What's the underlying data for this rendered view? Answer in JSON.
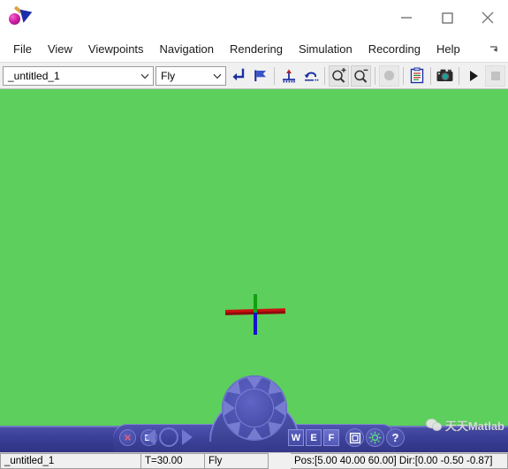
{
  "window": {
    "title": "",
    "app_icon": "webots-logo-icon",
    "controls": [
      {
        "name": "minimize-button",
        "icon": "minimize-icon",
        "label": "—"
      },
      {
        "name": "maximize-button",
        "icon": "maximize-icon",
        "label": "□"
      },
      {
        "name": "close-button",
        "icon": "close-icon",
        "label": "✕"
      }
    ]
  },
  "menubar": {
    "items": [
      {
        "label": "File"
      },
      {
        "label": "View"
      },
      {
        "label": "Viewpoints"
      },
      {
        "label": "Navigation"
      },
      {
        "label": "Rendering"
      },
      {
        "label": "Simulation"
      },
      {
        "label": "Recording"
      },
      {
        "label": "Help"
      }
    ],
    "overflow_icon": "overflow-chevron-icon"
  },
  "toolbar": {
    "world_combo": {
      "value": "_untitled_1",
      "placeholder": "_untitled_1",
      "icon": "chevron-down-icon"
    },
    "mode_combo": {
      "value": "Fly",
      "placeholder": "Fly",
      "icon": "chevron-down-icon"
    },
    "buttons": [
      {
        "name": "apply-button",
        "icon": "enter-arrow-icon",
        "label": "Apply",
        "enabled": true
      },
      {
        "name": "flag-button",
        "icon": "flag-icon",
        "label": "Flag",
        "enabled": true
      },
      {
        "name": "reset-viewpoint-button",
        "icon": "anchor-icon",
        "label": "Reset",
        "enabled": true
      },
      {
        "name": "undo-move-button",
        "icon": "undo-arrow-icon",
        "label": "Undo",
        "enabled": true
      },
      {
        "name": "zoom-in-button",
        "icon": "zoom-in-icon",
        "label": "Zoom In",
        "enabled": true
      },
      {
        "name": "zoom-out-button",
        "icon": "zoom-out-icon",
        "label": "Zoom Out",
        "enabled": true
      },
      {
        "name": "record-button",
        "icon": "record-circle-icon",
        "label": "Record",
        "enabled": false
      },
      {
        "name": "console-button",
        "icon": "clipboard-icon",
        "label": "Console",
        "enabled": true
      },
      {
        "name": "screenshot-button",
        "icon": "camera-icon",
        "label": "Screenshot",
        "enabled": true
      },
      {
        "name": "play-button",
        "icon": "play-icon",
        "label": "Play",
        "enabled": true
      },
      {
        "name": "stop-button",
        "icon": "stop-square-icon",
        "label": "Stop",
        "enabled": false
      }
    ]
  },
  "viewport": {
    "background_color": "#5CCF5C",
    "axis_gizmo": {
      "name": "axis-gizmo",
      "x_axis_color": "#CC1111",
      "y_axis_color": "#12A012",
      "z_axis_color": "#1414CC"
    }
  },
  "dashboard": {
    "left_buttons": [
      {
        "name": "dash-close-button",
        "icon": "x-circle-icon",
        "glyph": "✕"
      },
      {
        "name": "dash-minimize-button",
        "icon": "window-icon",
        "glyph": "▬"
      }
    ],
    "nav_arrows": {
      "left": {
        "name": "dash-rotate-left-button",
        "icon": "triangle-left-icon"
      },
      "right": {
        "name": "dash-rotate-right-button",
        "icon": "triangle-right-icon"
      },
      "ring": {
        "name": "dash-orbit-ring",
        "icon": "ring-icon"
      }
    },
    "knob": {
      "name": "dash-pan-knob",
      "icon": "compass-knob-icon",
      "segments": 8
    },
    "mode_keys": [
      {
        "name": "dash-key-w",
        "label": "W",
        "active": false
      },
      {
        "name": "dash-key-e",
        "label": "E",
        "active": false
      },
      {
        "name": "dash-key-f",
        "label": "F",
        "active": true
      }
    ],
    "right_buttons": [
      {
        "name": "dash-fullscreen-button",
        "icon": "nested-square-icon"
      },
      {
        "name": "dash-light-button",
        "icon": "sun-icon"
      },
      {
        "name": "dash-help-button",
        "icon": "question-mark-icon",
        "glyph": "?"
      }
    ]
  },
  "watermark": {
    "icon": "wechat-icon",
    "text": "天天Matlab"
  },
  "statusbar": {
    "world": "_untitled_1",
    "time": "T=30.00",
    "mode": "Fly",
    "position": "Pos:[5.00 40.00 60.00] Dir:[0.00 -0.50 -0.87]"
  }
}
